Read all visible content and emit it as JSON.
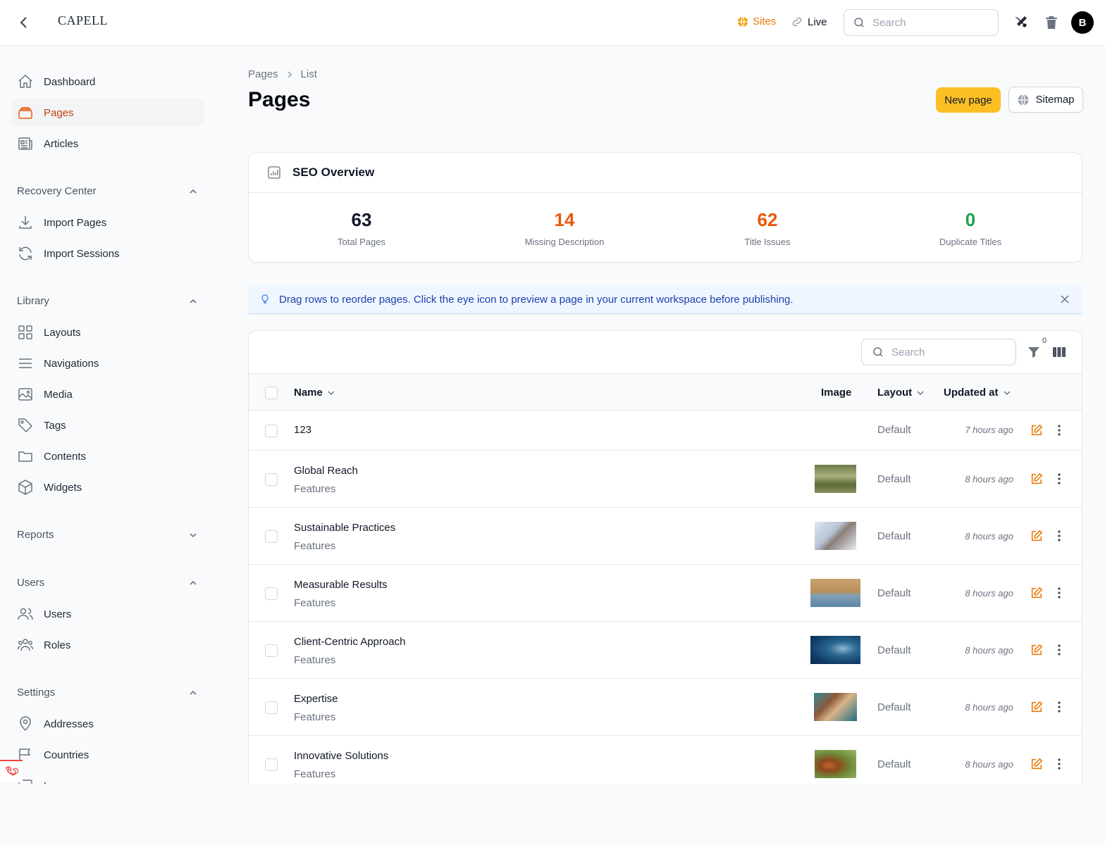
{
  "topbar": {
    "logo": "CAPELL",
    "sites_label": "Sites",
    "live_label": "Live",
    "search_placeholder": "Search",
    "avatar_initial": "B"
  },
  "sidebar": {
    "items": [
      {
        "label": "Dashboard",
        "icon": "home-icon"
      },
      {
        "label": "Pages",
        "icon": "pages-icon",
        "active": true
      },
      {
        "label": "Articles",
        "icon": "newspaper-icon"
      }
    ],
    "groups": [
      {
        "title": "Recovery Center",
        "items": [
          {
            "label": "Import Pages"
          },
          {
            "label": "Import Sessions"
          }
        ]
      },
      {
        "title": "Library",
        "items": [
          {
            "label": "Layouts"
          },
          {
            "label": "Navigations"
          },
          {
            "label": "Media"
          },
          {
            "label": "Tags"
          },
          {
            "label": "Contents"
          },
          {
            "label": "Widgets"
          }
        ]
      },
      {
        "title": "Reports",
        "items": []
      },
      {
        "title": "Users",
        "items": [
          {
            "label": "Users"
          },
          {
            "label": "Roles"
          }
        ]
      },
      {
        "title": "Settings",
        "items": [
          {
            "label": "Addresses"
          },
          {
            "label": "Countries"
          },
          {
            "label": "L"
          }
        ]
      }
    ]
  },
  "breadcrumb": [
    "Pages",
    "List"
  ],
  "page_title": "Pages",
  "actions": {
    "new_page": "New page",
    "sitemap": "Sitemap"
  },
  "seo": {
    "title": "SEO Overview",
    "stats": [
      {
        "value": "63",
        "label": "Total Pages",
        "color": "#111827"
      },
      {
        "value": "14",
        "label": "Missing Description",
        "color": "#ea580c"
      },
      {
        "value": "62",
        "label": "Title Issues",
        "color": "#ea580c"
      },
      {
        "value": "0",
        "label": "Duplicate Titles",
        "color": "#16a34a"
      }
    ]
  },
  "info_message": "Drag rows to reorder pages. Click the eye icon to preview a page in your current workspace before publishing.",
  "table": {
    "search_placeholder": "Search",
    "filter_count": "0",
    "columns": {
      "name": "Name",
      "image": "Image",
      "layout": "Layout",
      "updated": "Updated at"
    },
    "rows": [
      {
        "name": "123",
        "sub": "",
        "layout": "Default",
        "updated": "7 hours ago",
        "image": ""
      },
      {
        "name": "Global Reach",
        "sub": "Features",
        "layout": "Default",
        "updated": "8 hours ago",
        "image": "meadow"
      },
      {
        "name": "Sustainable Practices",
        "sub": "Features",
        "layout": "Default",
        "updated": "8 hours ago",
        "image": "cat"
      },
      {
        "name": "Measurable Results",
        "sub": "Features",
        "layout": "Default",
        "updated": "8 hours ago",
        "image": "shore"
      },
      {
        "name": "Client-Centric Approach",
        "sub": "Features",
        "layout": "Default",
        "updated": "8 hours ago",
        "image": "shark"
      },
      {
        "name": "Expertise",
        "sub": "Features",
        "layout": "Default",
        "updated": "8 hours ago",
        "image": "dogs"
      },
      {
        "name": "Innovative Solutions",
        "sub": "Features",
        "layout": "Default",
        "updated": "8 hours ago",
        "image": "bird"
      }
    ]
  },
  "colors": {
    "accent": "#fbbf24",
    "active_nav": "#c2410c",
    "edit_icon": "#ea7c0c"
  }
}
